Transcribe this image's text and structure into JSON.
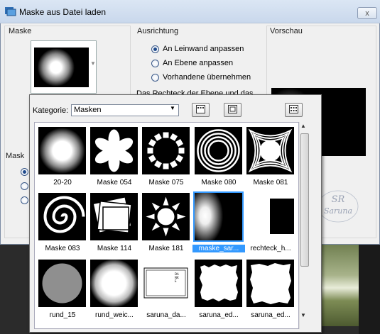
{
  "window": {
    "title": "Maske aus Datei laden",
    "close_symbol": "x"
  },
  "groups": {
    "maske": "Maske",
    "ausrichtung": "Ausrichtung",
    "vorschau": "Vorschau",
    "maske_lower": "Mask"
  },
  "ausrichtung_options": [
    {
      "label": "An Leinwand anpassen",
      "checked": true
    },
    {
      "label": "An Ebene anpassen",
      "checked": false
    },
    {
      "label": "Vorhandene übernehmen",
      "checked": false
    }
  ],
  "hint_text": "Das Rechteck der Ebene und das",
  "popup": {
    "kategorie_label": "Kategorie:",
    "kategorie_value": "Masken"
  },
  "masks": [
    {
      "label": "20-20",
      "icon": "radial-circle-icon"
    },
    {
      "label": "Maske 054",
      "icon": "flower-icon"
    },
    {
      "label": "Maske 075",
      "icon": "dotted-ring-icon"
    },
    {
      "label": "Maske 080",
      "icon": "concentric-circles-icon"
    },
    {
      "label": "Maske 081",
      "icon": "ornamental-frame-icon"
    },
    {
      "label": "Maske 083",
      "icon": "spiral-icon"
    },
    {
      "label": "Maske 114",
      "icon": "stacked-frames-icon"
    },
    {
      "label": "Maske 181",
      "icon": "sun-icon"
    },
    {
      "label": "maske_sar...",
      "icon": "gradient-blur-icon",
      "selected": true
    },
    {
      "label": "rechteck_h...",
      "icon": "rectangle-icon"
    },
    {
      "label": "rund_15",
      "icon": "gray-circle-icon"
    },
    {
      "label": "rund_weic...",
      "icon": "soft-circle-icon"
    },
    {
      "label": "saruna_da...",
      "icon": "framed-text-icon",
      "thumb_text": "DANKE"
    },
    {
      "label": "saruna_ed...",
      "icon": "rough-edge-icon"
    },
    {
      "label": "saruna_ed...",
      "icon": "rough-edge-icon-2"
    }
  ],
  "watermark": {
    "initials": "SR",
    "name": "Saruna"
  },
  "colors": {
    "selection": "#3399ff",
    "title_bar": "#d2dff0"
  }
}
